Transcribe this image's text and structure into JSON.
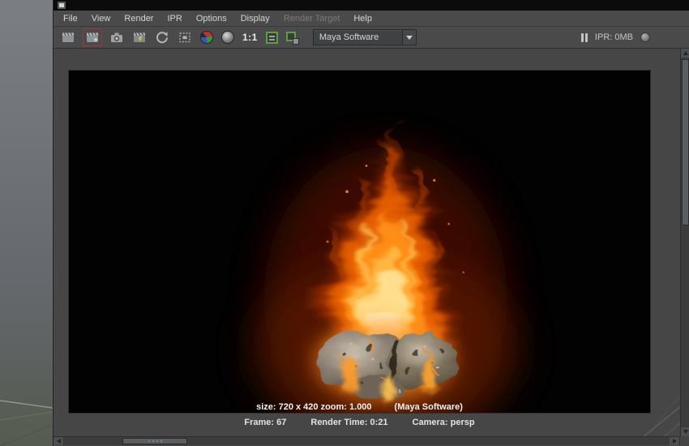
{
  "menubar": {
    "items": [
      {
        "label": "File",
        "enabled": true
      },
      {
        "label": "View",
        "enabled": true
      },
      {
        "label": "Render",
        "enabled": true
      },
      {
        "label": "IPR",
        "enabled": true
      },
      {
        "label": "Options",
        "enabled": true
      },
      {
        "label": "Display",
        "enabled": true
      },
      {
        "label": "Render Target",
        "enabled": false
      },
      {
        "label": "Help",
        "enabled": true
      }
    ]
  },
  "toolbar": {
    "renderer_select": {
      "value": "Maya Software"
    },
    "one_to_one_label": "1:1",
    "ipr_memory_label": "IPR: 0MB",
    "icons": [
      {
        "name": "render-current-frame-icon"
      },
      {
        "name": "redo-previous-render-icon",
        "highlighted": true
      },
      {
        "name": "snapshot-icon"
      },
      {
        "name": "ipr-render-icon"
      },
      {
        "name": "refresh-render-icon"
      },
      {
        "name": "render-region-icon"
      },
      {
        "name": "rgb-channels-icon"
      },
      {
        "name": "alpha-channel-icon"
      },
      {
        "name": "one-to-one-icon"
      },
      {
        "name": "keep-image-icon"
      },
      {
        "name": "remove-image-icon"
      },
      {
        "name": "pause-ipr-icon"
      },
      {
        "name": "ipr-memory-indicator-icon"
      }
    ],
    "colors": {
      "keep_image_green": "#55a23f",
      "redo_highlight_red": "#a23434"
    }
  },
  "render_view": {
    "status_line": {
      "size_label": "size: 720 x 420 zoom: 1.000",
      "renderer_label": "(Maya Software)"
    },
    "info_line": {
      "frame_label": "Frame: 67",
      "render_time_label": "Render Time: 0:21",
      "camera_label": "Camera: persp"
    }
  }
}
